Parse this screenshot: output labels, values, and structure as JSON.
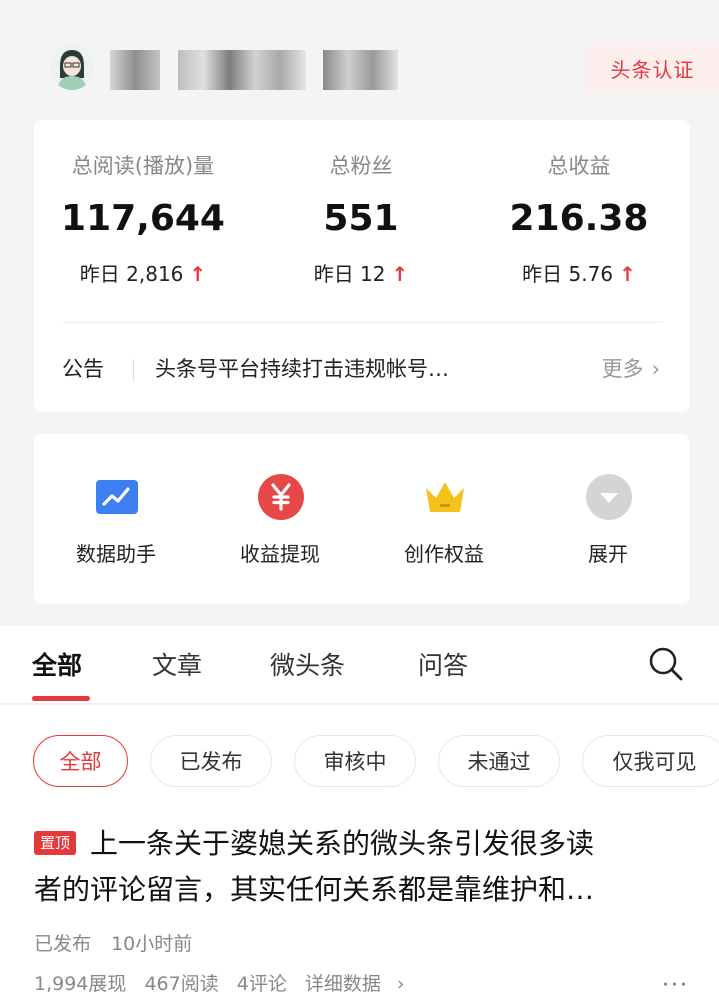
{
  "header": {
    "verify_label": "头条认证"
  },
  "stats": [
    {
      "label": "总阅读(播放)量",
      "value": "117,644",
      "delta": "昨日 2,816"
    },
    {
      "label": "总粉丝",
      "value": "551",
      "delta": "昨日 12"
    },
    {
      "label": "总收益",
      "value": "216.38",
      "delta": "昨日 5.76"
    }
  ],
  "notice": {
    "tag": "公告",
    "text": "头条号平台持续打击违规帐号…",
    "more": "更多"
  },
  "shortcuts": [
    {
      "label": "数据助手",
      "icon": "chart-icon"
    },
    {
      "label": "收益提现",
      "icon": "yuan-icon"
    },
    {
      "label": "创作权益",
      "icon": "crown-icon"
    },
    {
      "label": "展开",
      "icon": "expand-icon"
    }
  ],
  "tabs": [
    "全部",
    "文章",
    "微头条",
    "问答"
  ],
  "filters": [
    "全部",
    "已发布",
    "审核中",
    "未通过",
    "仅我可见"
  ],
  "post": {
    "badge": "置顶",
    "title_line1": "上一条关于婆媳关系的微头条引发很多读",
    "title_line2": "者的评论留言，其实任何关系都是靠维护和…",
    "status": "已发布",
    "time": "10小时前",
    "views": "1,994展现",
    "reads": "467阅读",
    "comments": "4评论",
    "detail": "详细数据"
  },
  "colors": {
    "accent": "#e5383b",
    "background": "#f4f4f4",
    "card": "#ffffff",
    "chart_blue": "#3d7ef0",
    "crown_gold": "#f5c21b"
  }
}
